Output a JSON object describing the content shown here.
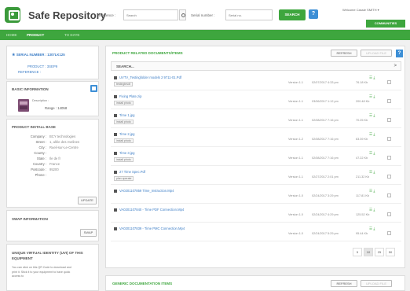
{
  "header": {
    "app_title": "Safe Repository",
    "reference_label": "Reference :",
    "reference_placeholder": "Search",
    "serial_label": "Serial number :",
    "serial_placeholder": "Serial no.",
    "search_button": "SEARCH",
    "help_button": "?",
    "welcome_text": "Welcome Cassie SMITH",
    "community_button": "COMMUNITIES"
  },
  "nav": {
    "items": [
      {
        "label": "HOME"
      },
      {
        "label": "PRODUCT"
      },
      {
        "label": "TO DATE"
      }
    ]
  },
  "serial_panel": {
    "serial_label": "SERIAL NUMBER : 1307LK125",
    "product_label": "PRODUCT : 3SEP9",
    "reference_label": "REFERENCE :"
  },
  "basic_info": {
    "title": "BASIC INFORMATION",
    "description": "Description :",
    "range_label": "Range :",
    "range_value": "14058"
  },
  "install_base": {
    "title": "PRODUCT INSTALL BASE",
    "fields": [
      {
        "key": "Company :",
        "value": "BCY technologies"
      },
      {
        "key": "Street :",
        "value": "1, allée des Avelines"
      },
      {
        "key": "City :",
        "value": "Rueil-sur-Le-Centre"
      },
      {
        "key": "County :",
        "value": ""
      },
      {
        "key": "State :",
        "value": "Ile de fr"
      },
      {
        "key": "Country :",
        "value": "France"
      },
      {
        "key": "Postcode :",
        "value": "95200"
      },
      {
        "key": "Phone :",
        "value": ""
      }
    ],
    "update_button": "UPDATE"
  },
  "swap": {
    "title": "SWAP INFORMATION",
    "swap_button": "SWAP"
  },
  "unique": {
    "title": "UNIQUE VIRTUAL IDENTITY (UVI) OF THIS EQUIPMENT",
    "text": "You can click on this QR Code to download and print it. Stick it to your equipment to have quick access to"
  },
  "documents": {
    "title": "PRODUCT RELATED DOCUMENTS/ITEMS",
    "refresh_button": "REFRESH",
    "upload_button": "UPLOAD FILE",
    "help_button": "?",
    "search_label": "SEARCH...",
    "search_arrow": ">",
    "rows": [
      {
        "name": "UVTV_Testingfolder models 2 9711-01.Pdf",
        "tags": "testingtesdt",
        "version": "Version 1.1",
        "date": "02/07/2017 4:33 pm",
        "size": "76.18 Kb"
      },
      {
        "name": "Fixing Plate.zip",
        "tags": "install  photo",
        "version": "Version 1.1",
        "date": "03/06/2017 1:12 pm",
        "size": "200.48 Kb"
      },
      {
        "name": "Time 1.jpg",
        "tags": "install  photo",
        "version": "Version 1.1",
        "date": "02/08/2017 7:16 pm",
        "size": "70.25 Kb"
      },
      {
        "name": "Time 2.jpg",
        "tags": "install  photo",
        "version": "Version 1.2",
        "date": "02/08/2017 7:16 pm",
        "size": "63.39 Kb"
      },
      {
        "name": "Time 3.jpg",
        "tags": "install  photo",
        "version": "Version 1.1",
        "date": "02/08/2017 7:16 pm",
        "size": "47.22 Kb"
      },
      {
        "name": "27 Time Spec.Pdf",
        "tags": "plan  operate",
        "version": "Version 1.1",
        "date": "02/27/2017 2:01 pm",
        "size": "211.32 Kb"
      },
      {
        "name": "VA0201107859 Time_Instruction.Mp4",
        "tags": "",
        "version": "Version 1.0",
        "date": "02/24/2017 3:29 pm",
        "size": "117.81 Kb"
      },
      {
        "name": "VA0201107840 - Time PDF Connection.Mp4",
        "tags": "",
        "version": "Version 1.0",
        "date": "02/24/2017 4:29 pm",
        "size": "125.52 Kb"
      },
      {
        "name": "VA0201107839 - Time PMC Connection.Mp4",
        "tags": "",
        "version": "Version 1.0",
        "date": "02/24/2017 5:29 pm",
        "size": "95.44 Kb"
      }
    ],
    "pager": [
      "5",
      "10",
      "25",
      "50"
    ]
  },
  "generic": {
    "title": "GENERIC DOCUMENTATION ITEMS",
    "refresh_button": "REFRESH",
    "upload_button": "UPLOAD FILE"
  },
  "colors": {
    "brand_green": "#3ea63e",
    "accent_blue": "#3d8fd6",
    "link_blue": "#3d7ec6"
  }
}
